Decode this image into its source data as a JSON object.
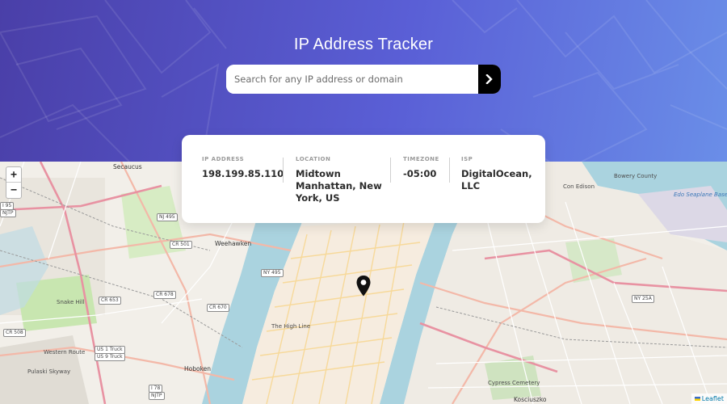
{
  "app": {
    "title": "IP Address Tracker"
  },
  "search": {
    "placeholder": "Search for any IP address or domain",
    "value": "",
    "button_icon": "chevron-right-icon"
  },
  "info": [
    {
      "label": "IP ADDRESS",
      "value": "198.199.85.110"
    },
    {
      "label": "LOCATION",
      "value": "Midtown Manhattan, New York, US"
    },
    {
      "label": "TIMEZONE",
      "value": "-05:00"
    },
    {
      "label": "ISP",
      "value": "DigitalOcean, LLC"
    }
  ],
  "map": {
    "zoom_in_label": "+",
    "zoom_out_label": "−",
    "attribution": "Leaflet",
    "marker_icon": "location-pin-icon",
    "labels": {
      "secaucus": "Secaucus",
      "weehawken": "Weehawken",
      "hoboken": "Hoboken",
      "high_line": "The High Line",
      "con_edison": "Con Edison",
      "seaplane": "Edo Seaplane Base",
      "bowery_county": "Bowery County",
      "cypress": "Cypress Cemetery",
      "kosciuszko": "Kosciuszko",
      "pulaski": "Pulaski Skyway",
      "western": "Western Route",
      "snake": "Snake Hill"
    },
    "shields": {
      "nj495": "NJ 495",
      "cr501": "CR 501",
      "cr678": "CR 678",
      "cr670": "CR 670",
      "cr653": "CR 653",
      "cr508": "CR 508",
      "ny495": "NY 495",
      "ny25a": "NY 25A",
      "us1": "US 1 Truck",
      "us9": "US 9 Truck",
      "i78": "I 78",
      "njtp": "NJTP",
      "i95": "I 95",
      "njtp2": "NJTP"
    }
  },
  "colors": {
    "header_start": "#4a3fa8",
    "header_end": "#6a8ee8",
    "search_button": "#000000",
    "water": "#aad3df",
    "land": "#f2efe9",
    "park": "#c8e6b0",
    "marker": "#111111"
  }
}
